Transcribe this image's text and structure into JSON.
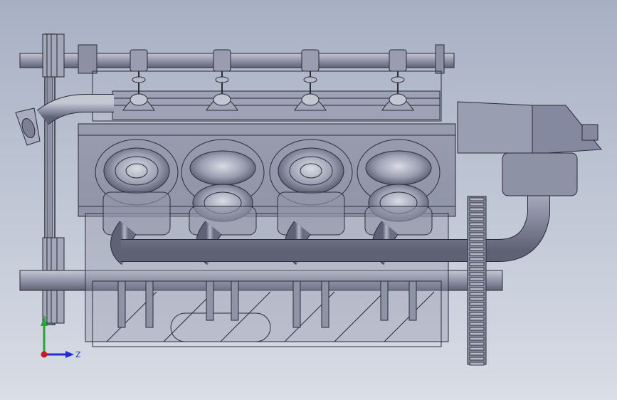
{
  "viewport": {
    "background_top": "#a7b0c3",
    "background_bottom": "#d8dde6"
  },
  "model": {
    "shade_color": "#8f93a6",
    "edge_color": "#2a2b35",
    "highlight_color": "#d6d8e2",
    "cylinder_count": 4
  },
  "triad": {
    "y_label": "Y",
    "z_label": "Z",
    "y_color": "#26a63a",
    "z_color": "#2030d0",
    "origin_color": "#d01818"
  }
}
